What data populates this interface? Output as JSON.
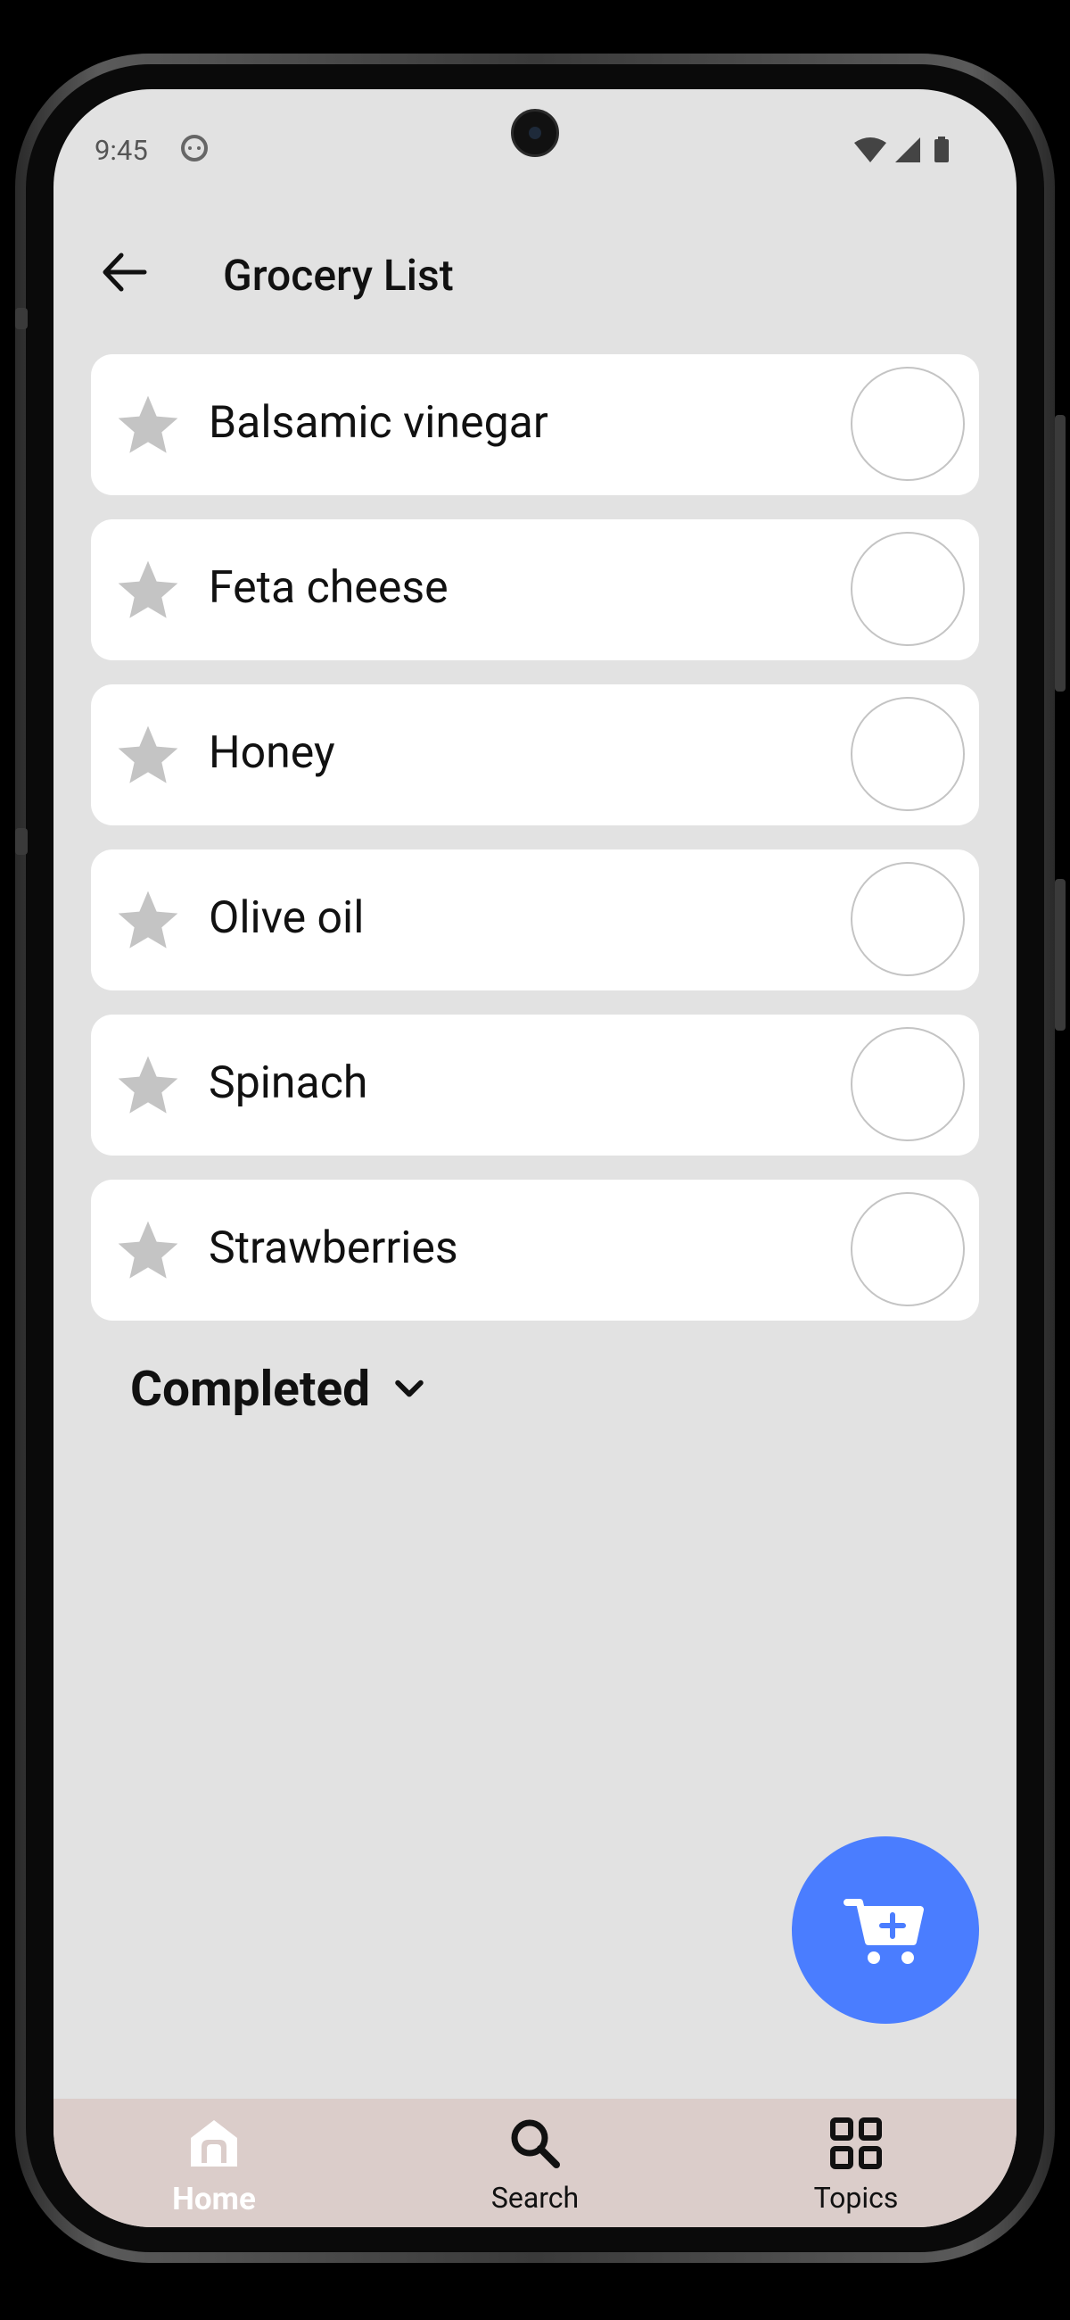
{
  "status_bar": {
    "time": "9:45"
  },
  "header": {
    "title": "Grocery List"
  },
  "items": [
    {
      "label": "Balsamic vinegar"
    },
    {
      "label": "Feta cheese"
    },
    {
      "label": "Honey"
    },
    {
      "label": "Olive oil"
    },
    {
      "label": "Spinach"
    },
    {
      "label": "Strawberries"
    }
  ],
  "completed_section": {
    "label": "Completed"
  },
  "bottom_nav": {
    "home": "Home",
    "search": "Search",
    "topics": "Topics"
  },
  "colors": {
    "fab": "#4a7dff",
    "nav_background": "#dbcdca",
    "screen_background": "#e2e2e2",
    "star": "#c4c4c4"
  },
  "icons": [
    "arrow-left-icon",
    "star-icon",
    "chevron-down-icon",
    "add-to-cart-icon",
    "home-icon",
    "search-icon",
    "grid-icon"
  ]
}
